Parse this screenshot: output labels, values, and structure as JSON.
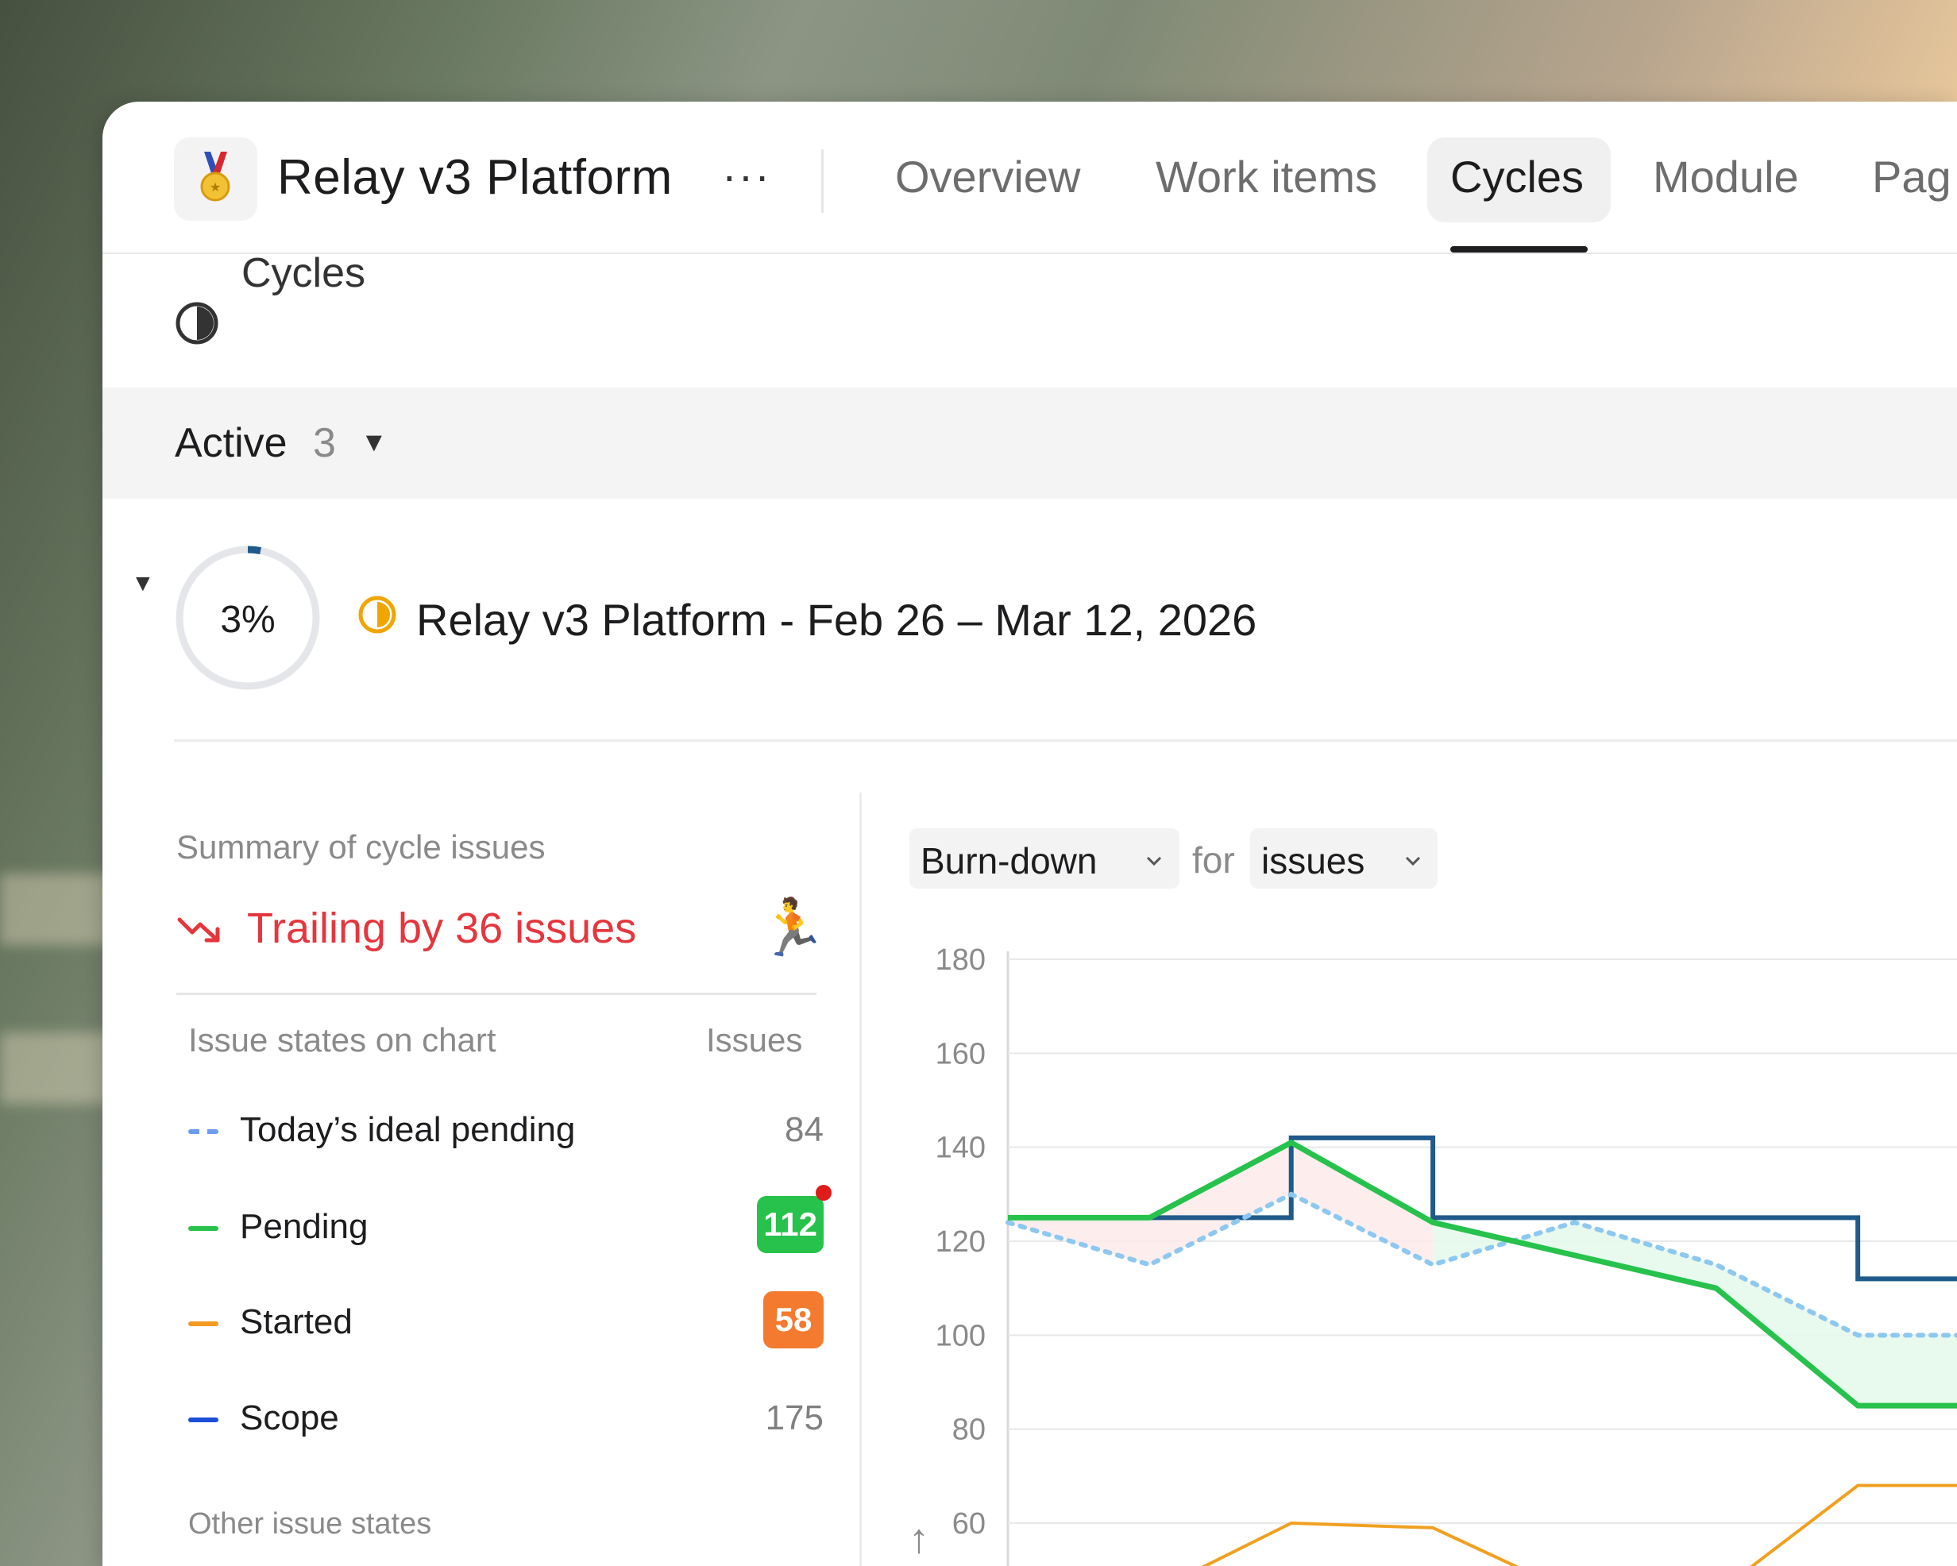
{
  "app": {
    "title": "Relay v3 Platform",
    "more": "···",
    "icon": "medal-icon"
  },
  "tabs": [
    {
      "label": "Overview",
      "active": false
    },
    {
      "label": "Work items",
      "active": false
    },
    {
      "label": "Cycles",
      "active": true
    },
    {
      "label": "Module",
      "active": false
    },
    {
      "label": "Pag",
      "active": false
    }
  ],
  "section": {
    "title": "Cycles",
    "icon": "half-circle-icon"
  },
  "filter": {
    "label": "Active",
    "count": "3"
  },
  "cycle": {
    "progress_percent": 3,
    "progress_label": "3%",
    "title": "Relay v3 Platform - Feb 26 – Mar 12, 2026",
    "status_color": "#f0a500"
  },
  "summary": {
    "label": "Summary of cycle issues",
    "trailing": "Trailing by 36 issues",
    "trailing_color": "#e5363d",
    "runner": "🏃",
    "col_states": "Issue states on chart",
    "col_issues": "Issues",
    "states": [
      {
        "name": "Today’s ideal pending",
        "count": "84",
        "color": "#6b9cf0",
        "style": "dashed",
        "badge": false
      },
      {
        "name": "Pending",
        "count": "112",
        "color": "#27c24c",
        "style": "solid",
        "badge": true,
        "badge_color": "#27c24c"
      },
      {
        "name": "Started",
        "count": "58",
        "color": "#f39a22",
        "style": "solid",
        "badge": true,
        "badge_color": "#f37a2e"
      },
      {
        "name": "Scope",
        "count": "175",
        "color": "#1b4fd8",
        "style": "solid",
        "badge": false
      }
    ],
    "other_label": "Other issue states"
  },
  "chart_controls": {
    "chart_type": "Burn-down",
    "for_label": "for",
    "metric": "issues"
  },
  "chart_data": {
    "type": "line",
    "y_ticks": [
      "180",
      "160",
      "140",
      "120",
      "100",
      "80",
      "60"
    ],
    "ylim": [
      60,
      180
    ],
    "x": [
      0,
      1,
      2,
      3,
      4,
      5,
      6,
      7
    ],
    "series": [
      {
        "key": "scope",
        "color": "#1f5a8a",
        "style": "step",
        "values": [
          125,
          125,
          142,
          125,
          125,
          125,
          112,
          112
        ]
      },
      {
        "key": "pending",
        "color": "#27c24c",
        "values": [
          125,
          125,
          141,
          124,
          117,
          110,
          85,
          85
        ]
      },
      {
        "key": "ideal",
        "color": "#8cc8f0",
        "style": "dotted",
        "values": [
          124,
          115,
          130,
          115,
          124,
          115,
          100,
          100
        ]
      },
      {
        "key": "started",
        "color": "#f0a020",
        "values": [
          45,
          45,
          60,
          59,
          45,
          45,
          68,
          68
        ]
      }
    ]
  }
}
